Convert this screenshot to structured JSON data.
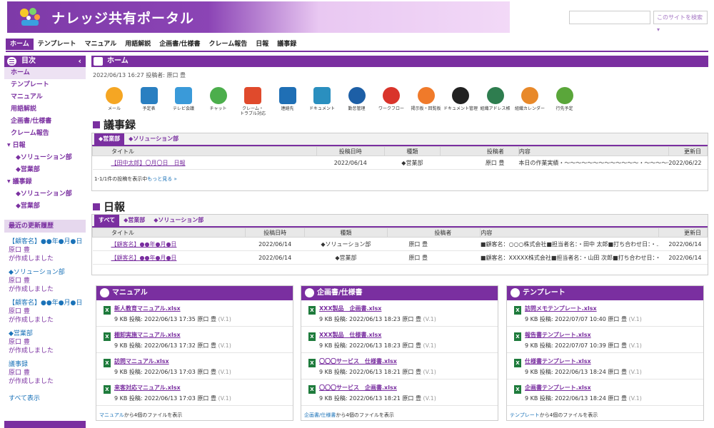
{
  "header": {
    "title": "ナレッジ共有ポータル",
    "search_placeholder": "",
    "search_scope": "このサイトを検索 ▾"
  },
  "gnav": [
    "ホーム",
    "テンプレート",
    "マニュアル",
    "用語解説",
    "企画書/仕様書",
    "クレーム報告",
    "日報",
    "議事録"
  ],
  "sidebar": {
    "toc_title": "目次",
    "items": [
      {
        "label": "ホーム",
        "level": 0,
        "active": true
      },
      {
        "label": "テンプレート",
        "level": 0
      },
      {
        "label": "マニュアル",
        "level": 0
      },
      {
        "label": "用語解説",
        "level": 0
      },
      {
        "label": "企画書/仕様書",
        "level": 0
      },
      {
        "label": "クレーム報告",
        "level": 0
      },
      {
        "label": "日報",
        "level": 0,
        "expanded": true
      },
      {
        "label": "◆ソリューション部",
        "level": 1
      },
      {
        "label": "◆営業部",
        "level": 1
      },
      {
        "label": "議事録",
        "level": 0,
        "expanded": true
      },
      {
        "label": "◆ソリューション部",
        "level": 1
      },
      {
        "label": "◆営業部",
        "level": 1
      }
    ],
    "recent_title": "最近の更新履歴",
    "recent": [
      {
        "title": "【顧客名】●●年●月●日",
        "user": "原口 豊",
        "note": "が作成しました"
      },
      {
        "title": "◆ソリューション部",
        "user": "原口 豊",
        "note": "が作成しました"
      },
      {
        "title": "【顧客名】●●年●月●日",
        "user": "原口 豊",
        "note": "が作成しました"
      },
      {
        "title": "◆営業部",
        "user": "原口 豊",
        "note": "が作成しました"
      },
      {
        "title": "議事録",
        "user": "原口 豊",
        "note": "が作成しました"
      }
    ],
    "show_all": "すべて表示"
  },
  "main": {
    "page_title": "ホーム",
    "meta": "2022/06/13 16:27 投稿者: 原口 豊",
    "apps": [
      {
        "label": "メール",
        "color": "#f5a623"
      },
      {
        "label": "予定表",
        "color": "#2a7fc1"
      },
      {
        "label": "テレビ会議",
        "color": "#3a9ad9"
      },
      {
        "label": "チャット",
        "color": "#4cae4c"
      },
      {
        "label": "クレーム・\nトラブル対応",
        "color": "#e04a2c"
      },
      {
        "label": "連絡先",
        "color": "#1f6fb5"
      },
      {
        "label": "ドキュメント",
        "color": "#2a8fbf"
      },
      {
        "label": "勤怠管理",
        "color": "#1d5fa6"
      },
      {
        "label": "ワークフロー",
        "color": "#d9342b"
      },
      {
        "label": "掲示板・回覧板",
        "color": "#f07a2a"
      },
      {
        "label": "ドキュメント管理",
        "color": "#222222"
      },
      {
        "label": "組織アドレス帳",
        "color": "#2e7d4f"
      },
      {
        "label": "組織カレンダー",
        "color": "#e8892a"
      },
      {
        "label": "行先予定",
        "color": "#5aa63a"
      }
    ],
    "minutes": {
      "title": "議事録",
      "tabs": [
        "◆営業部",
        "◆ソリューション部"
      ],
      "columns": [
        "タイトル",
        "投稿日時",
        "種類",
        "投稿者",
        "内容",
        "更新日"
      ],
      "rows": [
        {
          "title": "【田中太郎】〇月〇日　日報",
          "date": "2022/06/14",
          "kind": "◆営業部",
          "author": "原口 豊",
          "content": "本日の作業実績・〜〜〜〜〜〜〜〜〜〜〜〜〜・〜〜〜〜〜〜〜〜〜…",
          "updated": "2022/06/22"
        }
      ],
      "footer": "1-1/1件の投稿を表示中",
      "more": "もっと見る »"
    },
    "daily": {
      "title": "日報",
      "tabs": [
        "すべて",
        "◆営業部",
        "◆ソリューション部"
      ],
      "columns": [
        "タイトル",
        "投稿日時",
        "種類",
        "投稿者",
        "内容",
        "更新日"
      ],
      "rows": [
        {
          "title": "【顧客名】●●年●月●日",
          "date": "2022/06/14",
          "kind": "◆ソリューション部",
          "author": "原口 豊",
          "content": "■顧客名：○○○株式会社■担当者名：・田中 太郎■打ち合わせ日：・…",
          "updated": "2022/06/14"
        },
        {
          "title": "【顧客名】●●年●月●日",
          "date": "2022/06/14",
          "kind": "◆営業部",
          "author": "原口 豊",
          "content": "■顧客名：XXXXX株式会社■担当者名：・山田 次郎■打ち合わせ日：・…",
          "updated": "2022/06/14"
        }
      ]
    },
    "boxes": [
      {
        "title": "マニュアル",
        "files": [
          {
            "name": "新人教育マニュアル.xlsx",
            "info": "9 KB  投稿: 2022/06/13 17:35 原口 豊",
            "ver": "(V.1)"
          },
          {
            "name": "棚卸実施マニュアル.xlsx",
            "info": "9 KB  投稿: 2022/06/13 17:32 原口 豊",
            "ver": "(V.1)"
          },
          {
            "name": "訪問マニュアル.xlsx",
            "info": "9 KB  投稿: 2022/06/13 17:03 原口 豊",
            "ver": "(V.1)"
          },
          {
            "name": "来客対応マニュアル.xlsx",
            "info": "9 KB  投稿: 2022/06/13 17:03 原口 豊",
            "ver": "(V.1)"
          }
        ],
        "foot_link": "マニュアル",
        "foot_text": "から4個のファイルを表示"
      },
      {
        "title": "企画書/仕様書",
        "files": [
          {
            "name": "XXX製品　企画書.xlsx",
            "info": "9 KB  投稿: 2022/06/13 18:23 原口 豊",
            "ver": "(V.1)"
          },
          {
            "name": "XXX製品　仕様書.xlsx",
            "info": "9 KB  投稿: 2022/06/13 18:23 原口 豊",
            "ver": "(V.1)"
          },
          {
            "name": "〇〇〇サービス　仕様書.xlsx",
            "info": "9 KB  投稿: 2022/06/13 18:21 原口 豊",
            "ver": "(V.1)"
          },
          {
            "name": "〇〇〇サービス　企画書.xlsx",
            "info": "9 KB  投稿: 2022/06/13 18:21 原口 豊",
            "ver": "(V.1)"
          }
        ],
        "foot_link": "企画書/仕様書",
        "foot_text": "から4個のファイルを表示"
      },
      {
        "title": "テンプレート",
        "files": [
          {
            "name": "訪問メモテンプレート.xlsx",
            "info": "9 KB  投稿: 2022/07/07 10:40 原口 豊",
            "ver": "(V.1)"
          },
          {
            "name": "報告書テンプレート.xlsx",
            "info": "9 KB  投稿: 2022/07/07 10:39 原口 豊",
            "ver": "(V.1)"
          },
          {
            "name": "仕様書テンプレート.xlsx",
            "info": "9 KB  投稿: 2022/06/13 18:24 原口 豊",
            "ver": "(V.1)"
          },
          {
            "name": "企画書テンプレート.xlsx",
            "info": "9 KB  投稿: 2022/06/13 18:24 原口 豊",
            "ver": "(V.1)"
          }
        ],
        "foot_link": "テンプレート",
        "foot_text": "から4個のファイルを表示"
      }
    ]
  }
}
